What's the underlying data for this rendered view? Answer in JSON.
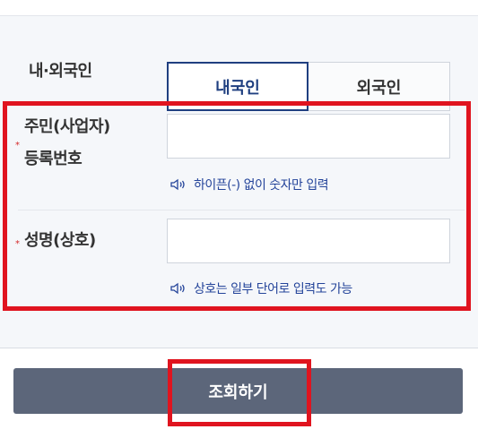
{
  "nationality": {
    "label": "내·외국인",
    "options": [
      "내국인",
      "외국인"
    ],
    "selected": "내국인"
  },
  "registration_number": {
    "label_line1": "주민(사업자)",
    "label_line2": "등록번호",
    "value": "",
    "hint": "하이픈(-) 없이 숫자만 입력",
    "hint_icon": "speaker-icon",
    "required": true
  },
  "name": {
    "label": "성명(상호)",
    "value": "",
    "hint": "상호는 일부 단어로 입력도 가능",
    "hint_icon": "speaker-icon",
    "required": true
  },
  "required_mark": "*",
  "submit_label": "조회하기",
  "colors": {
    "accent": "#1f3f80",
    "hint": "#24449a",
    "required": "#d42a2a",
    "highlight": "#e0141f",
    "button": "#5c667a"
  }
}
